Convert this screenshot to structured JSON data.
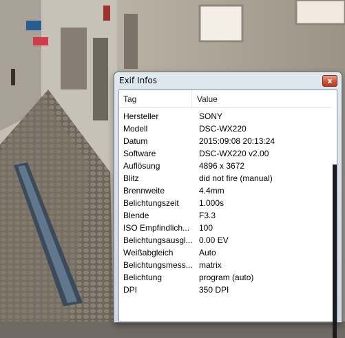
{
  "window": {
    "title": "Exif Infos",
    "close_label": "x"
  },
  "table": {
    "columns": [
      "Tag",
      "Value"
    ],
    "rows": [
      {
        "tag": "Hersteller",
        "value": "SONY"
      },
      {
        "tag": "Modell",
        "value": "DSC-WX220"
      },
      {
        "tag": "Datum",
        "value": "2015:09:08 20:13:24"
      },
      {
        "tag": "Software",
        "value": "DSC-WX220 v2.00"
      },
      {
        "tag": "Auflösung",
        "value": "4896 x 3672"
      },
      {
        "tag": "Blitz",
        "value": "did not fire (manual)"
      },
      {
        "tag": "Brennweite",
        "value": "4.4mm"
      },
      {
        "tag": "Belichtungszeit",
        "value": "1.000s"
      },
      {
        "tag": "Blende",
        "value": "F3.3"
      },
      {
        "tag": "ISO Empfindlich...",
        "value": "100"
      },
      {
        "tag": "Belichtungsausgl...",
        "value": "0.00 EV"
      },
      {
        "tag": "Weißabgleich",
        "value": "Auto"
      },
      {
        "tag": "Belichtungsmess...",
        "value": "matrix"
      },
      {
        "tag": "Belichtung",
        "value": "program (auto)"
      },
      {
        "tag": "DPI",
        "value": "350 DPI"
      }
    ]
  },
  "colors": {
    "dialog_frame": "#dfe7ef",
    "close_button": "#cf5a3b",
    "list_background": "#ffffff"
  }
}
